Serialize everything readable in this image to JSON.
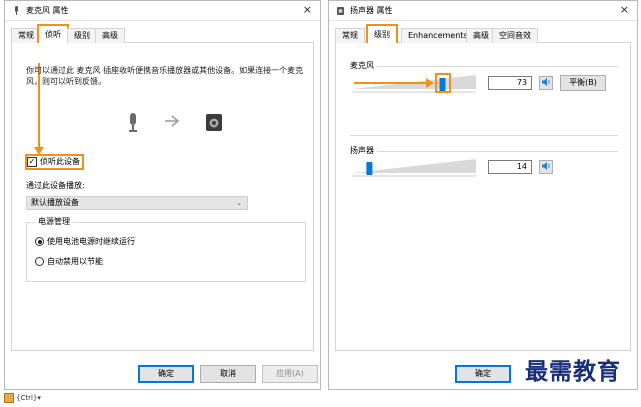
{
  "left_dialog": {
    "title": "麦克风 属性",
    "close": "×",
    "tabs": [
      "常规",
      "侦听",
      "级别",
      "高级"
    ],
    "description": "你可以通过此 麦克风 插座收听便携音乐播放器或其他设备。如果连接一个麦克风，则可以听到反馈。",
    "listen_checkbox": {
      "label": "侦听此设备",
      "checked": "☑"
    },
    "playback_label": "通过此设备播放:",
    "playback_select": "默认播放设备",
    "power_group": {
      "title": "电源管理",
      "options": [
        "使用电池电源时继续运行",
        "自动禁用以节能"
      ]
    },
    "buttons": {
      "ok": "确定",
      "cancel": "取消",
      "apply": "应用(A)"
    }
  },
  "right_dialog": {
    "title": "扬声器 属性",
    "close": "×",
    "tabs": [
      "常规",
      "级别",
      "Enhancements",
      "高级",
      "空间音效"
    ],
    "mic": {
      "label": "麦克风",
      "value": "73",
      "balance": "平衡(B)",
      "level": 0.73
    },
    "speaker": {
      "label": "扬声器",
      "value": "14",
      "level": 0.14
    },
    "buttons": {
      "ok": "确定"
    }
  },
  "watermark": "最需教育",
  "footer_text": "{Ctrl}▾",
  "colors": {
    "highlight": "#f0911f",
    "accent": "#0078d7"
  },
  "icons": {
    "speaker": "speaker-icon",
    "mic": "microphone-icon",
    "device": "speaker-device-icon"
  }
}
